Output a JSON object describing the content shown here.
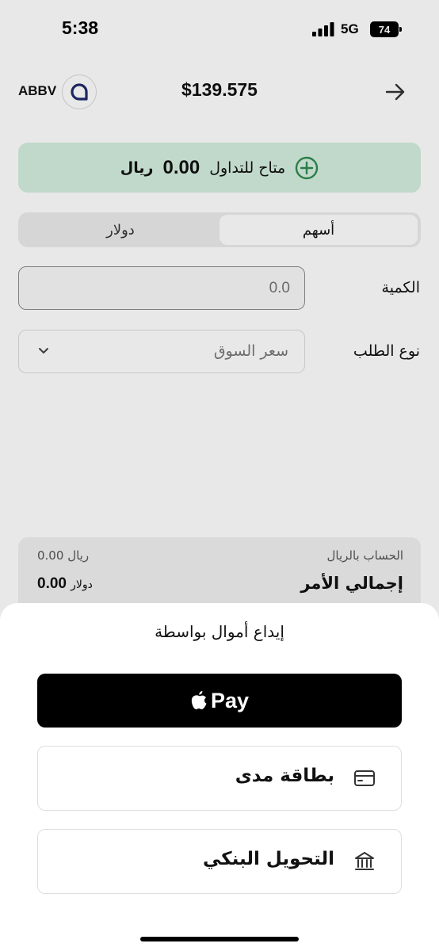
{
  "status_bar": {
    "time": "5:38",
    "network": "5G",
    "battery": "74"
  },
  "header": {
    "ticker": "ABBV",
    "price": "$139.575",
    "back_icon": "arrow-right-icon"
  },
  "available": {
    "label": "متاح للتداول",
    "amount": "0.00",
    "currency": "ريال",
    "icon": "plus-circle-icon"
  },
  "segments": {
    "active": "أسهم",
    "inactive": "دولار"
  },
  "form": {
    "quantity_label": "الكمية",
    "quantity_placeholder": "0.0",
    "order_type_label": "نوع الطلب",
    "order_type_value": "سعر السوق"
  },
  "summary": {
    "account_label": "الحساب بالريال",
    "total_label": "إجمالي الأمر",
    "sar_value": "0.00",
    "sar_currency": "ريال",
    "usd_value": "0.00",
    "usd_currency": "دولار"
  },
  "sheet": {
    "title": "إيداع أموال بواسطة",
    "apple_pay_label": "Pay",
    "options": [
      {
        "label": "بطاقة مدى",
        "icon": "card-icon"
      },
      {
        "label": "التحويل البنكي",
        "icon": "bank-icon"
      }
    ]
  },
  "colors": {
    "green_bg": "#d4efe0",
    "green_accent": "#2f8a4d",
    "accent_logo": "#1f2a6b"
  }
}
